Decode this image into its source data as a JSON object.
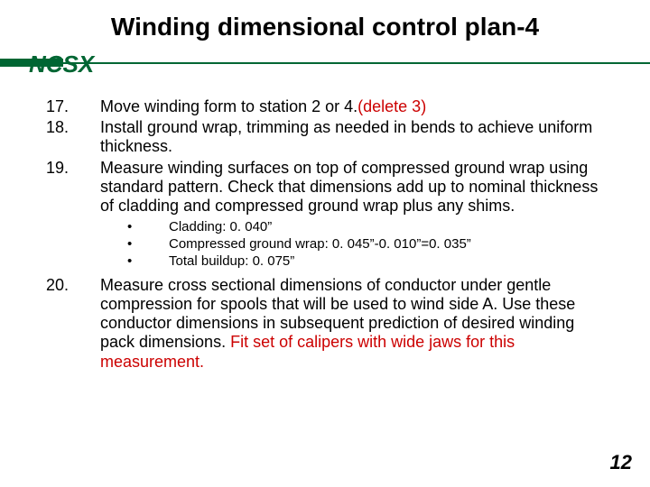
{
  "title": "Winding dimensional control plan-4",
  "logo": "NCSX",
  "items": [
    {
      "num": "17.",
      "text": "Move winding form to station 2 or 4.",
      "edit": "(delete 3)"
    },
    {
      "num": "18.",
      "text": "Install ground wrap, trimming as needed in bends to achieve uniform thickness."
    },
    {
      "num": "19.",
      "text": "Measure winding surfaces on top of compressed ground wrap using standard pattern. Check that dimensions add up to nominal thickness of cladding and compressed ground wrap plus any shims."
    }
  ],
  "sub": [
    "Cladding: 0. 040”",
    "Compressed ground wrap: 0. 045”-0. 010”=0. 035”",
    "Total buildup: 0. 075”"
  ],
  "item20": {
    "num": "20.",
    "text": "Measure cross sectional dimensions of conductor under gentle compression for spools that will be used to wind side A. Use these conductor dimensions in subsequent prediction of desired winding pack dimensions. ",
    "edit": "Fit set of calipers with wide jaws for this measurement."
  },
  "page": "12",
  "bullet": "•"
}
